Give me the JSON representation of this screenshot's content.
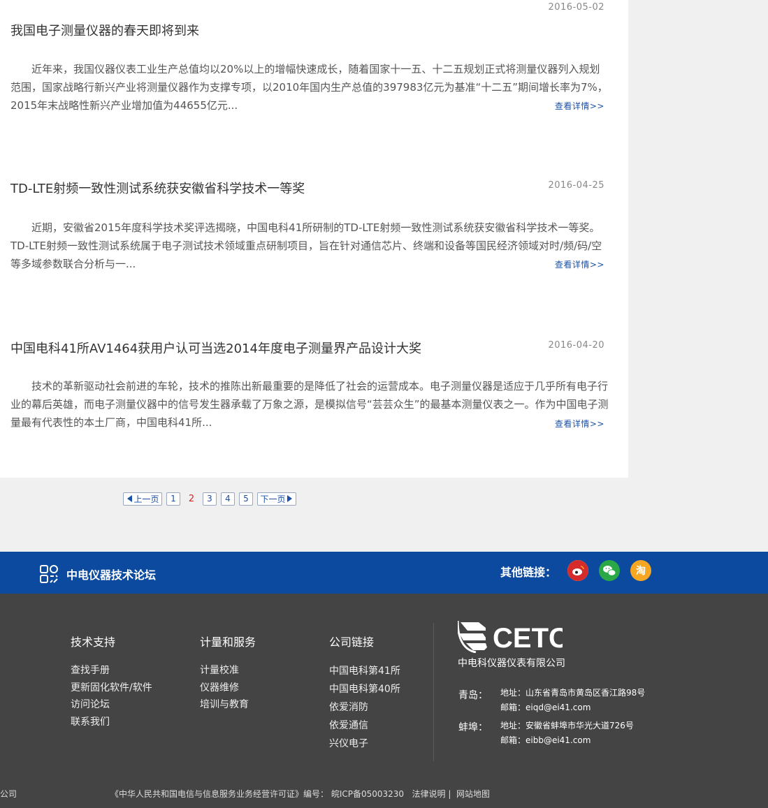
{
  "articles": [
    {
      "date": "2016-05-02",
      "title": "我国电子测量仪器的春天即将到来",
      "body": "　　近年来，我国仪器仪表工业生产总值均以20%以上的增幅快速成长，随着国家十一五、十二五规划正式将测量仪器列入规划范围，国家战略行新兴产业将测量仪器作为支撑专项，以2010年国内生产总值的397983亿元为基准“十二五”期间增长率为7%，2015年末战略性新兴产业增加值为44655亿元...",
      "more": "查看详情>>"
    },
    {
      "date": "2016-04-25",
      "title": "TD-LTE射频一致性测试系统获安徽省科学技术一等奖",
      "body": "　　近期，安徽省2015年度科学技术奖评选揭晓，中国电科41所研制的TD-LTE射频一致性测试系统获安徽省科学技术一等奖。TD-LTE射频一致性测试系统属于电子测试技术领域重点研制项目，旨在针对通信芯片、终端和设备等国民经济领域对时/频/码/空等多域参数联合分析与一...",
      "more": "查看详情>>"
    },
    {
      "date": "2016-04-20",
      "title": "中国电科41所AV1464获用户认可当选2014年度电子测量界产品设计大奖",
      "body": "　　技术的革新驱动社会前进的车轮，技术的推陈出新最重要的是降低了社会的运营成本。电子测量仪器是适应于几乎所有电子行业的幕后英雄，而电子测量仪器中的信号发生器承载了万象之源，是模拟信号“芸芸众生”的最基本测量仪表之一。作为中国电子测量最有代表性的本土厂商，中国电科41所...",
      "more": "查看详情>>"
    }
  ],
  "pager": {
    "prev": "上一页",
    "next": "下一页",
    "pages": [
      "1",
      "2",
      "3",
      "4",
      "5"
    ],
    "current": "2"
  },
  "bluebar": {
    "forum": "中电仪器技术论坛",
    "other_links": "其他链接：",
    "taobao_glyph": "淘",
    "colors": {
      "bar": "#0b4a9e",
      "weibo": "#d52c2b",
      "wechat": "#2aa846",
      "taobao": "#f5a623"
    }
  },
  "footer": {
    "col1": {
      "head": "技术支持",
      "links": [
        "查找手册",
        "更新固化软件/软件",
        "访问论坛",
        "联系我们"
      ]
    },
    "col2": {
      "head": "计量和服务",
      "links": [
        "计量校准",
        "仪器维修",
        "培训与教育"
      ]
    },
    "col3": {
      "head": "公司链接",
      "links": [
        "中国电科第41所",
        "中国电科第40所",
        "依爱消防",
        "依爱通信",
        "兴仪电子"
      ]
    },
    "logo_text": "CETC",
    "company": "中电科仪器仪表有限公司",
    "qingdao": {
      "city": "青岛：",
      "addr": "地址：山东省青岛市黄岛区香江路98号",
      "email": "邮箱：eiqd@ei41.com"
    },
    "bengbu": {
      "city": "蚌埠：",
      "addr": "地址：安徽省蚌埠市华光大道726号",
      "email": "邮箱：eibb@ei41.com"
    },
    "bottom_left": "公司",
    "license": "《中华人民共和国电信与信息服务业务经营许可证》编号：  皖ICP备05003230",
    "legal": "法律说明",
    "sep": "|",
    "sitemap": "网站地图"
  }
}
